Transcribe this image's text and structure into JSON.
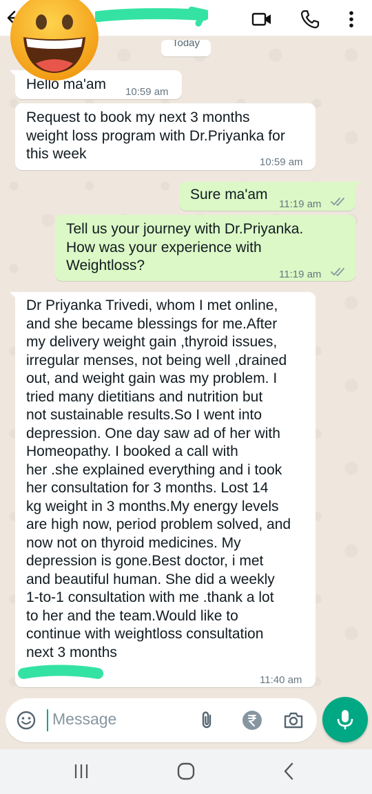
{
  "header": {
    "contact_name": ""
  },
  "date_chip": "Today",
  "composer": {
    "placeholder": "Message"
  },
  "messages": [
    {
      "dir": "in",
      "text": "Hello ma'am",
      "time": "10:59 am"
    },
    {
      "dir": "in",
      "text": "Request to book my next 3 months\nweight loss program with Dr.Priyanka for\nthis week",
      "time": "10:59 am"
    },
    {
      "dir": "out",
      "text": "Sure ma'am",
      "time": "11:19 am",
      "status": "read"
    },
    {
      "dir": "out",
      "text": "Tell us your journey with Dr.Priyanka.\nHow was your experience with\nWeightloss?",
      "time": "11:19 am",
      "status": "read"
    },
    {
      "dir": "in",
      "text": "Dr Priyanka Trivedi, whom I met online,\nand she became blessings for me.After\nmy delivery weight gain ,thyroid issues,\nirregular menses, not being well ,drained\nout, and weight gain was my problem. I\ntried many dietitians and nutrition but\nnot sustainable results.So I went into\ndepression. One day saw ad of her with\nHomeopathy. I booked a call with\nher .she explained everything and i took\nher consultation for 3 months. Lost 14\nkg weight in 3 months.My energy levels\nare high now, period problem solved, and\nnow not on thyroid medicines. My\ndepression is gone.Best doctor, i met\nand beautiful human. She did a weekly\n1-to-1 consultation with me .thank a lot\nto her and the team.Would like to\ncontinue with weightloss consultation\nnext 3 months",
      "time": "11:40 am"
    }
  ],
  "colors": {
    "accent": "#00a884",
    "outgoing": "#dcf8c6",
    "incoming": "#ffffff",
    "read_ticks": "#8696a0",
    "redaction": "#34e3a4"
  },
  "icons": [
    "back-arrow-icon",
    "video-call-icon",
    "voice-call-icon",
    "more-options-icon",
    "emoji-icon",
    "attach-icon",
    "rupee-payment-icon",
    "camera-icon",
    "mic-icon",
    "recent-apps-icon",
    "home-icon",
    "nav-back-icon"
  ]
}
